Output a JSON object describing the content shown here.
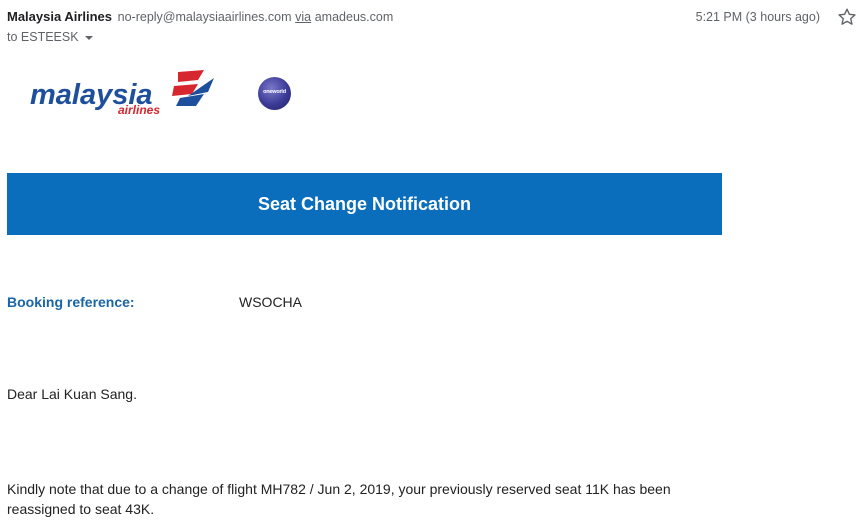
{
  "email": {
    "sender_name": "Malaysia Airlines",
    "sender_email": "no-reply@malaysiaairlines.com",
    "via_label": "via",
    "via_domain": "amadeus.com",
    "to_line": "to ESTEESK",
    "timestamp": "5:21 PM (3 hours ago)"
  },
  "brand": {
    "logo_text": "malaysia",
    "logo_subtext": "airlines",
    "alliance_label": "oneworld",
    "colors": {
      "logo_blue": "#1d4f9c",
      "logo_red": "#d6262e",
      "banner_blue": "#0a6ebd",
      "label_blue": "#1a64a8"
    }
  },
  "banner": {
    "title": "Seat Change Notification"
  },
  "booking": {
    "label": "Booking reference:",
    "value": "WSOCHA"
  },
  "message": {
    "greeting": "Dear Lai Kuan Sang.",
    "body": "Kindly note that due to a change of flight MH782 / Jun 2, 2019, your previously reserved seat 11K has been reassigned to seat 43K."
  },
  "icons": {
    "star": "star-icon",
    "caret": "chevron-down-icon"
  }
}
